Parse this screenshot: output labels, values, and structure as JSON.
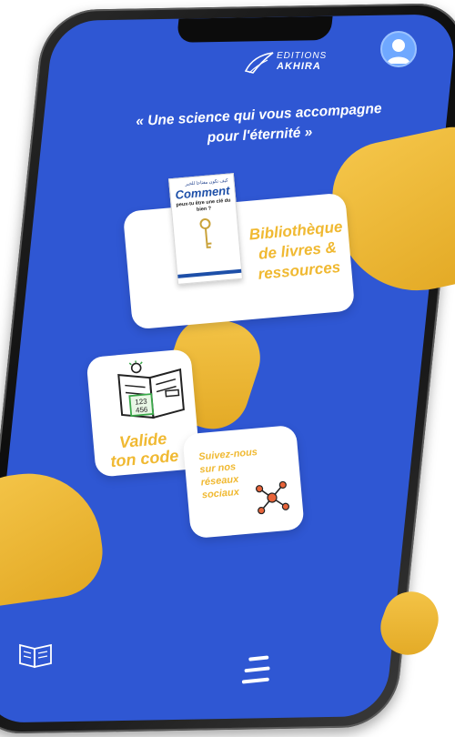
{
  "header": {
    "logo_line1": "EDITIONS",
    "logo_line2": "AKHIRA",
    "avatar_icon": "user-avatar-icon"
  },
  "tagline": {
    "line1": "« Une science qui vous accompagne",
    "line2": "pour l'éternité »"
  },
  "library_card": {
    "book_arabic": "كيف تكون مفتاحا للخير",
    "book_title": "Comment",
    "book_subtitle": "peux-tu être une clé du bien ?",
    "label_line1": "Bibliothèque",
    "label_line2": "de livres &",
    "label_line3": "ressources"
  },
  "code_card": {
    "icon": "code-book-icon",
    "icon_digits_1": "123",
    "icon_digits_2": "456",
    "label_line1": "Valide",
    "label_line2": "ton code"
  },
  "social_card": {
    "label_line1": "Suivez-nous",
    "label_line2": "sur nos",
    "label_line3": "réseaux",
    "label_line4": "sociaux",
    "icon": "share-network-icon"
  },
  "bottom_bar": {
    "left_icon": "open-book-icon",
    "right_icon": "menu-icon"
  },
  "colors": {
    "screen_bg": "#2f57d3",
    "accent_gold": "#f0b932",
    "card_bg": "#ffffff"
  }
}
